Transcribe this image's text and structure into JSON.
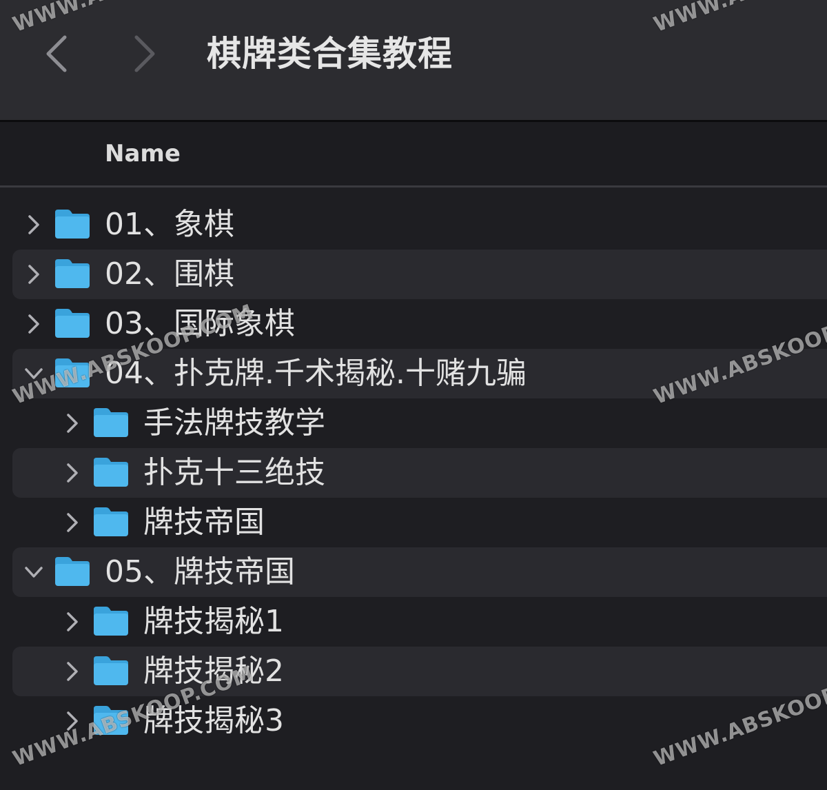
{
  "window": {
    "title": "棋牌类合集教程"
  },
  "toolbar": {
    "back_icon": "chevron-left-icon",
    "forward_icon": "chevron-right-icon"
  },
  "columns": {
    "name": "Name"
  },
  "colors": {
    "folder": "#4fb8ee",
    "folder_tab": "#3aa3dc",
    "background": "#1e1e22",
    "row_alt": "#2a2a2f",
    "toolbar": "#2c2c30",
    "text": "#e2e2e2"
  },
  "rows": [
    {
      "label": "01、象棋",
      "level": 0,
      "expanded": false
    },
    {
      "label": "02、围棋",
      "level": 0,
      "expanded": false
    },
    {
      "label": "03、国际象棋",
      "level": 0,
      "expanded": false
    },
    {
      "label": "04、扑克牌.千术揭秘.十赌九骗",
      "level": 0,
      "expanded": true
    },
    {
      "label": "手法牌技教学",
      "level": 1,
      "expanded": false
    },
    {
      "label": "扑克十三绝技",
      "level": 1,
      "expanded": false
    },
    {
      "label": "牌技帝国",
      "level": 1,
      "expanded": false
    },
    {
      "label": "05、牌技帝国",
      "level": 0,
      "expanded": true
    },
    {
      "label": "牌技揭秘1",
      "level": 1,
      "expanded": false
    },
    {
      "label": "牌技揭秘2",
      "level": 1,
      "expanded": false
    },
    {
      "label": "牌技揭秘3",
      "level": 1,
      "expanded": false
    }
  ],
  "watermarks": [
    "WWW.ABSKOOP.COM",
    "WWW.ABSKOOP.COM",
    "WWW.ABSKOOP.COM",
    "WWW.ABSKOOP.COM",
    "WWW.ABSKOOP.COM",
    "WWW.ABSKOOP.COM"
  ]
}
